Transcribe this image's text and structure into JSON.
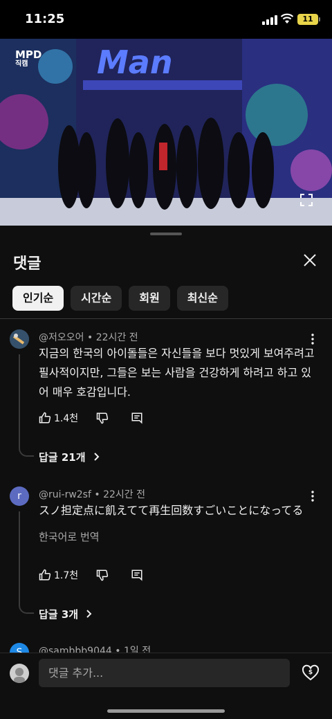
{
  "status_bar": {
    "time": "11:25",
    "battery": "11"
  },
  "video": {
    "channel_logo_text": "MPD",
    "channel_logo_sub": "직캠"
  },
  "sheet": {
    "title": "댓글",
    "filters": [
      "인기순",
      "시간순",
      "회원",
      "최신순"
    ],
    "active_filter": "인기순"
  },
  "comments": [
    {
      "author": "@저오오어",
      "time": "22시간 전",
      "text": "지금의 한국의 아이돌들은 자신들을 보다 멋있게 보여주려고 필사적이지만, 그들은 보는 사람을 건강하게 하려고 하고 있어 매우 호감입니다.",
      "likes": "1.4천",
      "replies": "답글 21개"
    },
    {
      "author": "@rui-rw2sf",
      "avatar_letter": "r",
      "time": "22시간 전",
      "text": "スノ担定点に飢えてて再生回数すごいことになってる",
      "translate": "한국어로 번역",
      "likes": "1.7천",
      "replies": "답글 3개"
    },
    {
      "author": "@sambbb9044",
      "avatar_letter": "S",
      "time": "1일 전"
    }
  ],
  "composer": {
    "placeholder": "댓글 추가..."
  },
  "colors": {
    "background": "#0f0f0f",
    "chip": "#272727",
    "avatar_r": "#5c6bc0",
    "avatar_s": "#1e88e5"
  }
}
